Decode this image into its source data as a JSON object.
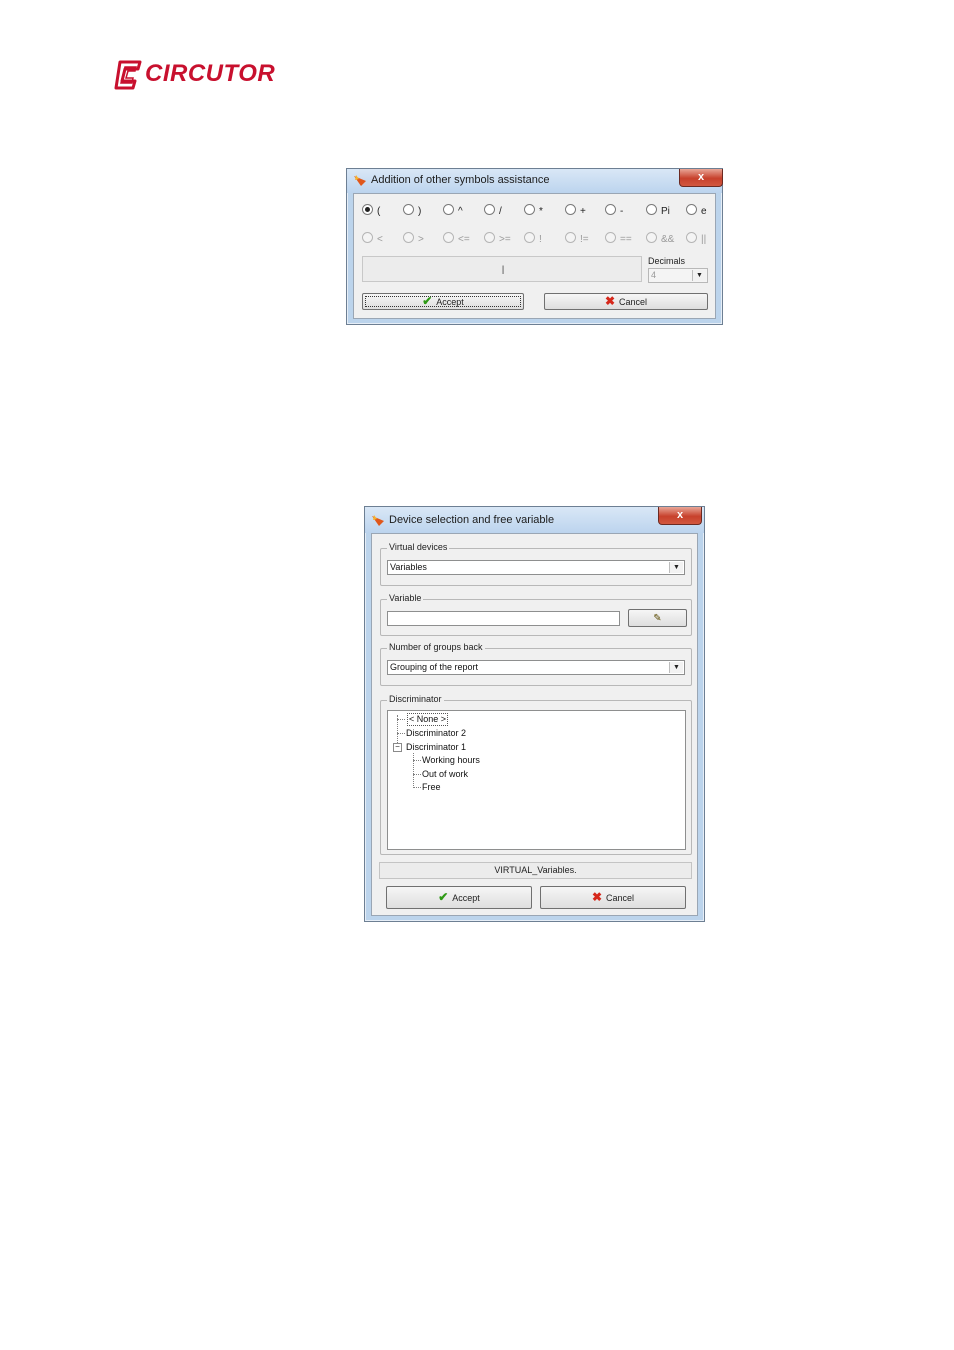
{
  "brand": {
    "name": "CIRCUTOR",
    "color": "#c8102e"
  },
  "dialog1": {
    "title": "Addition of other symbols assistance",
    "close_label": "x",
    "row1": [
      {
        "label": "(",
        "checked": true
      },
      {
        "label": ")",
        "checked": false
      },
      {
        "label": "^",
        "checked": false
      },
      {
        "label": "/",
        "checked": false
      },
      {
        "label": "*",
        "checked": false
      },
      {
        "label": "+",
        "checked": false
      },
      {
        "label": "-",
        "checked": false
      },
      {
        "label": "Pi",
        "checked": false
      },
      {
        "label": "e",
        "checked": false
      }
    ],
    "row2": [
      {
        "label": "<"
      },
      {
        "label": ">"
      },
      {
        "label": "<="
      },
      {
        "label": ">="
      },
      {
        "label": "!"
      },
      {
        "label": "!="
      },
      {
        "label": "=="
      },
      {
        "label": "&&"
      },
      {
        "label": "||"
      }
    ],
    "expression_value": "|",
    "decimals_label": "Decimals",
    "decimals_value": "4",
    "accept_label": "Accept",
    "cancel_label": "Cancel"
  },
  "dialog2": {
    "title": "Device selection and free variable",
    "close_label": "x",
    "virtual_devices_label": "Virtual devices",
    "virtual_devices_value": "Variables",
    "variable_label": "Variable",
    "variable_value": "",
    "groups_back_label": "Number of groups back",
    "groups_back_value": "Grouping of the report",
    "discriminator_label": "Discriminator",
    "tree": {
      "none": "< None >",
      "disc2": "Discriminator 2",
      "disc1": "Discriminator 1",
      "children": [
        "Working hours",
        "Out of work",
        "Free"
      ]
    },
    "status_text": "VIRTUAL_Variables.",
    "accept_label": "Accept",
    "cancel_label": "Cancel"
  }
}
